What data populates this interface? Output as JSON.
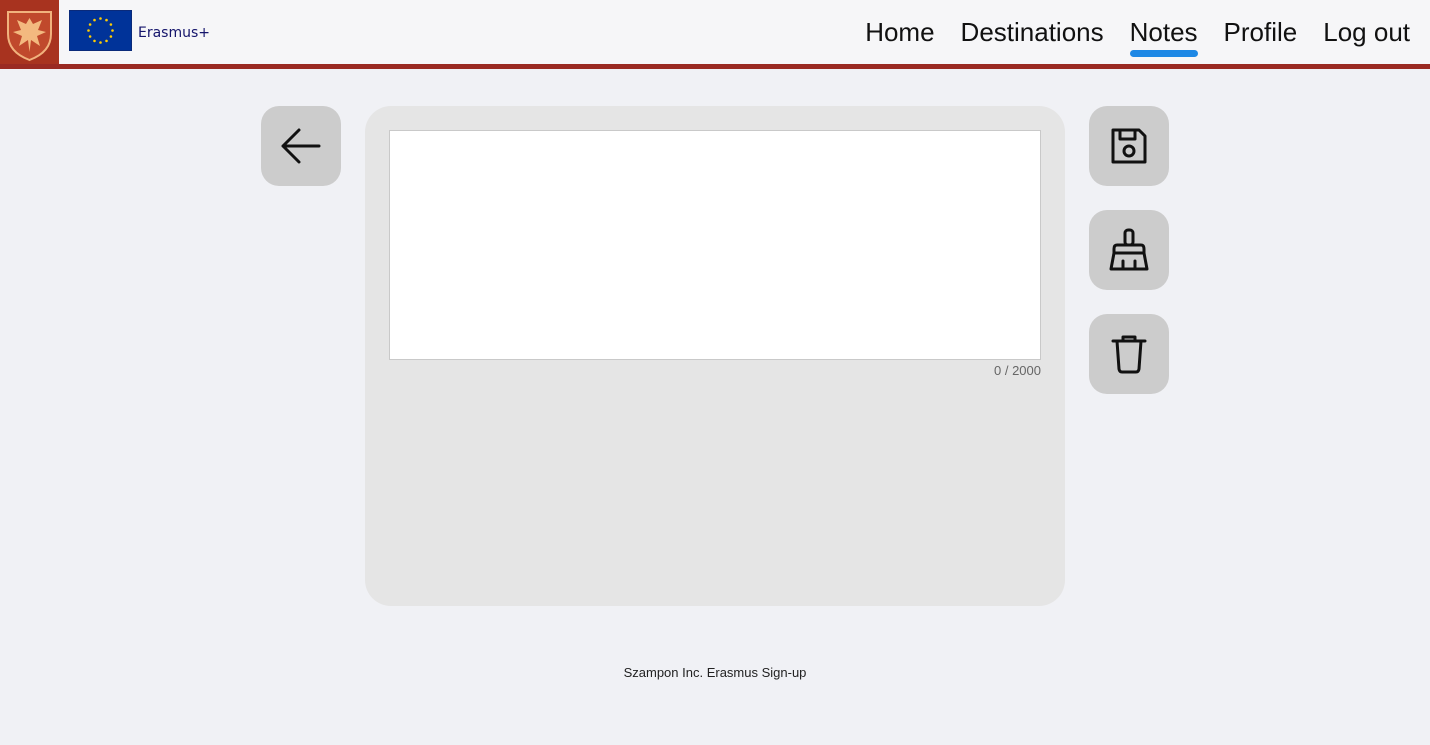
{
  "header": {
    "logo_icon": "eagle-crest-icon",
    "flag_icon": "eu-flag-icon",
    "brand_label": "Erasmus+",
    "nav": [
      {
        "label": "Home",
        "active": false
      },
      {
        "label": "Destinations",
        "active": false
      },
      {
        "label": "Notes",
        "active": true
      },
      {
        "label": "Profile",
        "active": false
      },
      {
        "label": "Log out",
        "active": false
      }
    ]
  },
  "editor": {
    "note_value": "",
    "counter": "0 / 2000"
  },
  "actions": {
    "back_icon": "arrow-left-icon",
    "save_icon": "floppy-disk-icon",
    "clear_icon": "broom-icon",
    "delete_icon": "trash-icon"
  },
  "footer": {
    "text": "Szampon Inc. Erasmus Sign-up"
  },
  "colors": {
    "header_border": "#9a2a22",
    "active_underline": "#1e88e5",
    "button_bg": "#cccccc",
    "panel_bg": "#e5e5e5"
  }
}
